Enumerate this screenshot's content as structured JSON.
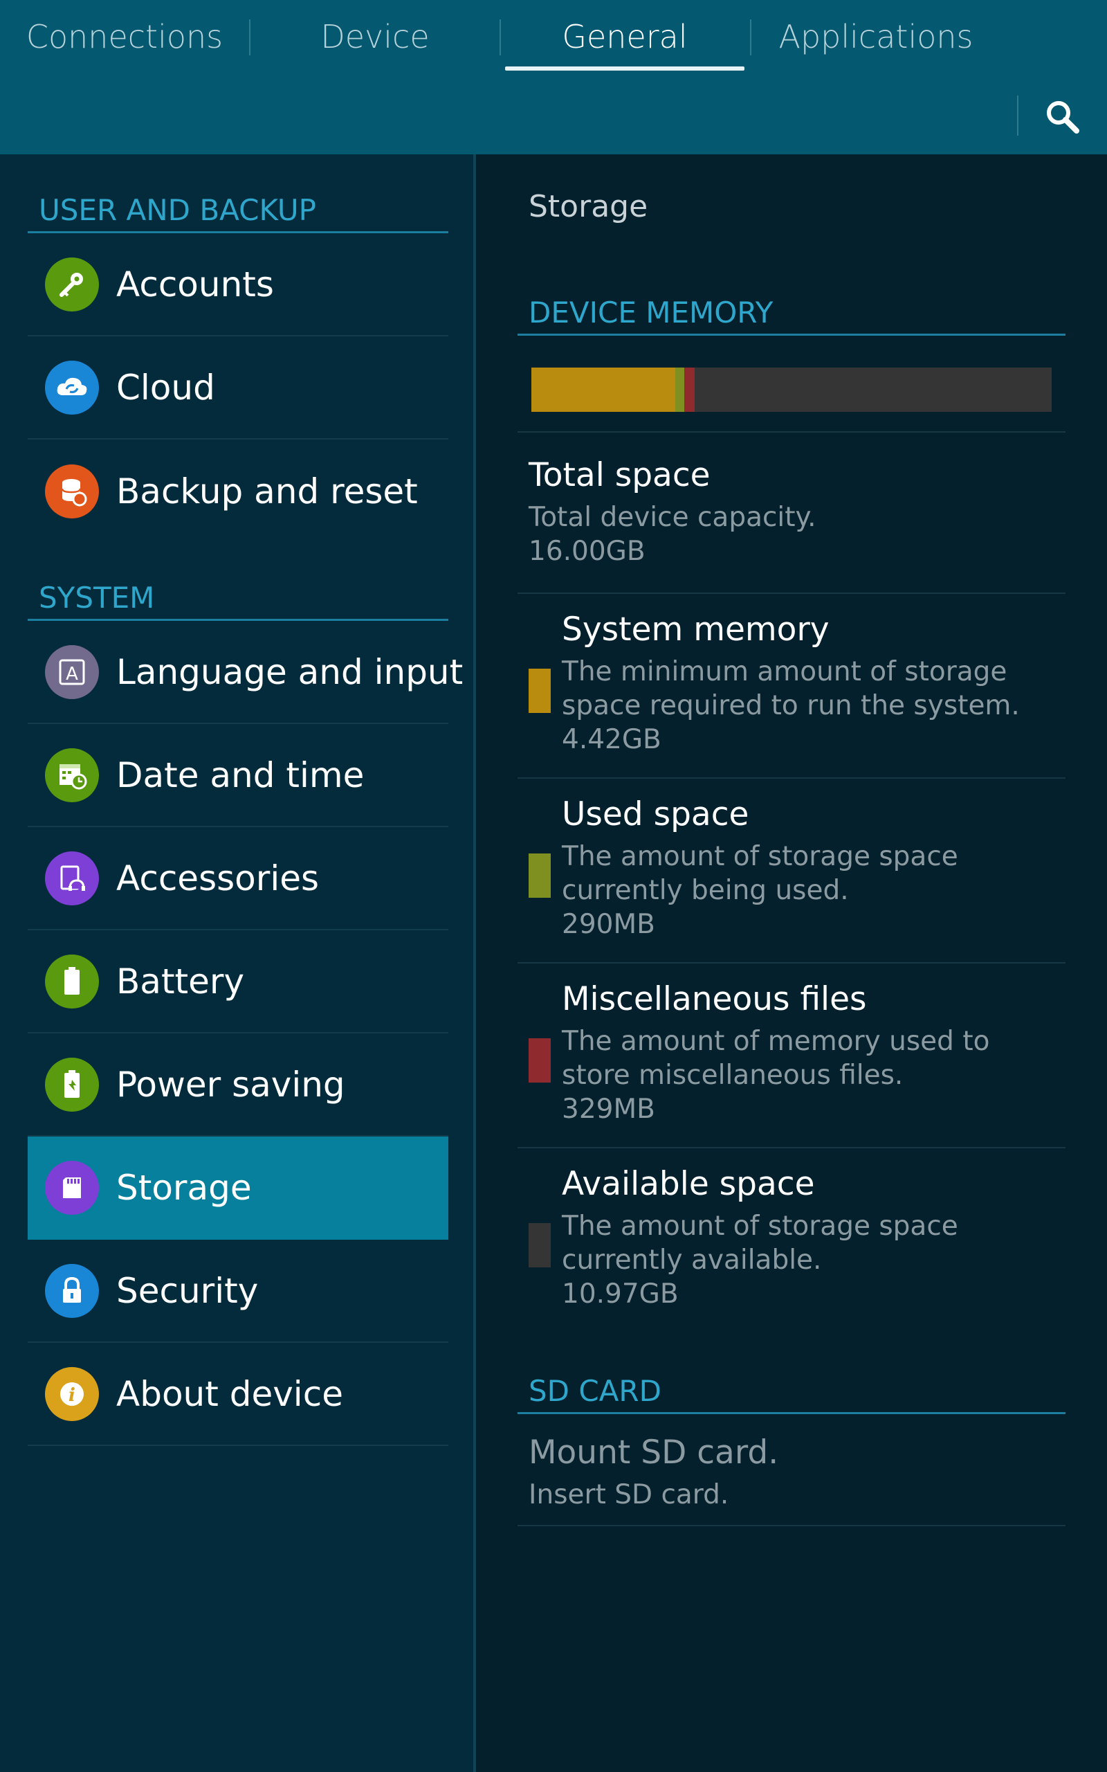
{
  "tabs": [
    {
      "label": "Connections",
      "active": false
    },
    {
      "label": "Device",
      "active": false
    },
    {
      "label": "General",
      "active": true
    },
    {
      "label": "Applications",
      "active": false
    }
  ],
  "search": {
    "icon": "search-icon"
  },
  "sidebar": {
    "sections": [
      {
        "header": "USER AND BACKUP",
        "items": [
          {
            "label": "Accounts",
            "icon": "key-icon",
            "color": "#5a9a0e"
          },
          {
            "label": "Cloud",
            "icon": "cloud-sync-icon",
            "color": "#1a86d6"
          },
          {
            "label": "Backup and reset",
            "icon": "backup-icon",
            "color": "#e2561b"
          }
        ]
      },
      {
        "header": "SYSTEM",
        "items": [
          {
            "label": "Language and input",
            "icon": "language-icon",
            "color": "#726b8e"
          },
          {
            "label": "Date and time",
            "icon": "calendar-clock-icon",
            "color": "#5a9a0e"
          },
          {
            "label": "Accessories",
            "icon": "accessories-icon",
            "color": "#7e3fd6"
          },
          {
            "label": "Battery",
            "icon": "battery-icon",
            "color": "#5a9a0e"
          },
          {
            "label": "Power saving",
            "icon": "power-saving-icon",
            "color": "#5a9a0e"
          },
          {
            "label": "Storage",
            "icon": "sd-card-icon",
            "color": "#7e3fd6",
            "selected": true
          },
          {
            "label": "Security",
            "icon": "lock-icon",
            "color": "#1a86d6"
          },
          {
            "label": "About device",
            "icon": "info-icon",
            "color": "#d9a21a"
          }
        ]
      }
    ]
  },
  "storage": {
    "title": "Storage",
    "device_memory_header": "DEVICE MEMORY",
    "total": {
      "title": "Total space",
      "desc": "Total device capacity.",
      "value": "16.00GB"
    },
    "items": [
      {
        "title": "System memory",
        "desc_line1": "The minimum amount of storage",
        "desc_line2": "space required to run the system.",
        "value": "4.42GB",
        "color": "#b98b0e",
        "fraction": 0.276
      },
      {
        "title": "Used space",
        "desc_line1": "The amount of storage space",
        "desc_line2": "currently being used.",
        "value": "290MB",
        "color": "#7f8f20",
        "fraction": 0.018
      },
      {
        "title": "Miscellaneous files",
        "desc_line1": "The amount of memory used to",
        "desc_line2": "store miscellaneous files.",
        "value": "329MB",
        "color": "#8f2b2f",
        "fraction": 0.02
      },
      {
        "title": "Available space",
        "desc_line1": "The amount of storage space",
        "desc_line2": "currently available.",
        "value": "10.97GB",
        "color": "#353535",
        "fraction": 0.686
      }
    ],
    "sd_header": "SD CARD",
    "sd": {
      "title": "Mount SD card.",
      "desc": "Insert SD card."
    }
  }
}
